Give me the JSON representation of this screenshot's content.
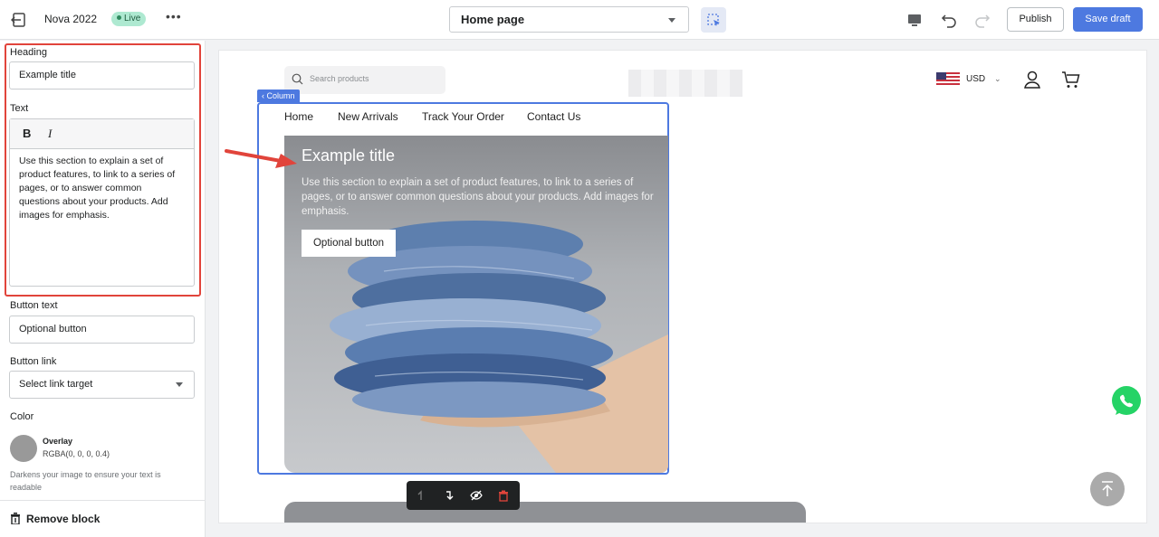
{
  "topbar": {
    "store_name": "Nova 2022",
    "status_badge": "Live",
    "page_selector": "Home page",
    "publish_label": "Publish",
    "save_label": "Save draft"
  },
  "sidebar": {
    "heading_label": "Heading",
    "heading_value": "Example title",
    "text_label": "Text",
    "text_bold": "B",
    "text_italic": "I",
    "text_value": "Use this section to explain a set of product features, to link to a series of pages, or to answer common questions about your products. Add images for emphasis.",
    "button_text_label": "Button text",
    "button_text_value": "Optional button",
    "button_link_label": "Button link",
    "button_link_value": "Select link target",
    "color_label": "Color",
    "overlay_name": "Overlay",
    "overlay_value": "RGBA(0, 0, 0, 0.4)",
    "overlay_help": "Darkens your image to ensure your text is readable",
    "remove_label": "Remove block",
    "highlight_color": "#e1443b"
  },
  "preview": {
    "search_placeholder": "Search products",
    "currency": "USD",
    "column_tag": "Column",
    "nav": [
      "Home",
      "New Arrivals",
      "Track Your Order",
      "Contact Us"
    ],
    "hero": {
      "title": "Example title",
      "text": "Use this section to explain a set of product features, to link to a series of pages, or to answer common questions about your products. Add images for emphasis.",
      "button": "Optional button"
    }
  },
  "colors": {
    "accent": "#4d79e0",
    "live_badge": "#aee9d1",
    "annotation_red": "#e1443b",
    "whatsapp": "#25d366"
  }
}
